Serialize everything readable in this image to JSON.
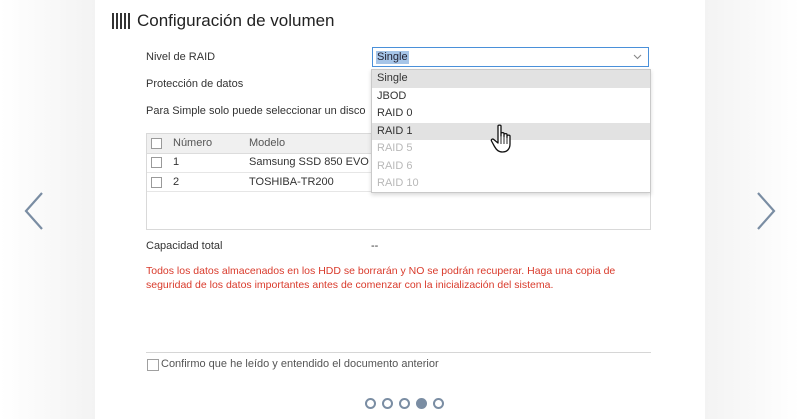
{
  "title": "Configuración de volumen",
  "form": {
    "raid_label": "Nivel de RAID",
    "raid_value": "Single",
    "protection_label": "Protección de datos",
    "simple_note": "Para Simple solo puede seleccionar un disco",
    "capacity_label": "Capacidad total",
    "capacity_value": "--"
  },
  "raid_options": [
    {
      "label": "Single",
      "state": "highlight"
    },
    {
      "label": "JBOD",
      "state": "enabled"
    },
    {
      "label": "RAID 0",
      "state": "enabled"
    },
    {
      "label": "RAID 1",
      "state": "hover"
    },
    {
      "label": "RAID 5",
      "state": "disabled"
    },
    {
      "label": "RAID 6",
      "state": "disabled"
    },
    {
      "label": "RAID 10",
      "state": "disabled"
    }
  ],
  "table": {
    "columns": [
      "Número",
      "Modelo"
    ],
    "rows": [
      {
        "number": "1",
        "model": "Samsung SSD 850 EVO 50"
      },
      {
        "number": "2",
        "model": "TOSHIBA-TR200"
      }
    ]
  },
  "warning": "Todos los datos almacenados en los HDD se borrarán y NO se podrán recuperar. Haga una copia de seguridad de los datos importantes antes de comenzar con la inicialización del sistema.",
  "confirm_label": "Confirmo que he leído y entendido el documento anterior",
  "pagination": {
    "total": 5,
    "current": 4
  },
  "colors": {
    "warning": "#d93a2b",
    "select_border": "#4a90d9",
    "dot": "#7a8da3"
  }
}
